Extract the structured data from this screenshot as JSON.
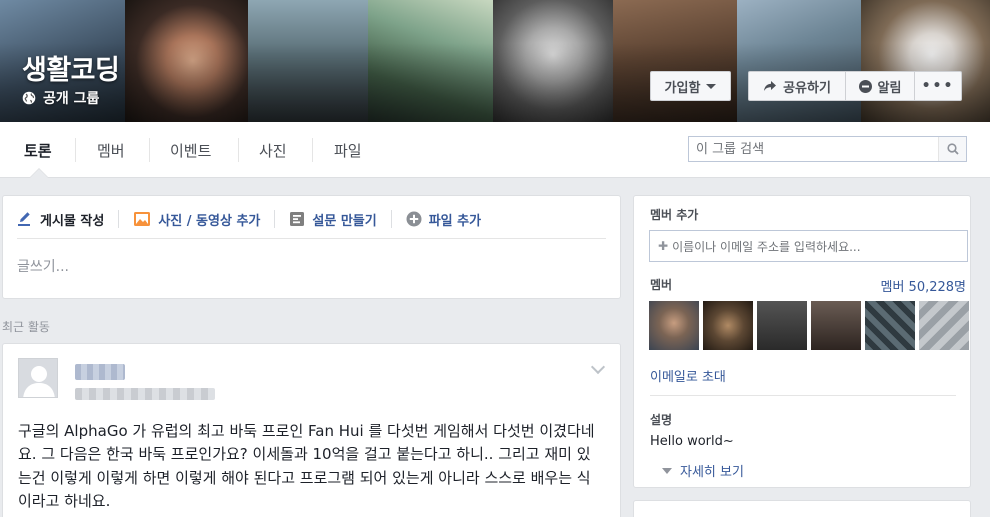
{
  "group": {
    "name": "생활코딩",
    "privacy": "공개 그룹"
  },
  "cover_actions": {
    "joined": "가입함",
    "share": "공유하기",
    "notifications": "알림",
    "more": "•••"
  },
  "tabs": [
    {
      "label": "토론",
      "active": true
    },
    {
      "label": "멤버",
      "active": false
    },
    {
      "label": "이벤트",
      "active": false
    },
    {
      "label": "사진",
      "active": false
    },
    {
      "label": "파일",
      "active": false
    }
  ],
  "search": {
    "placeholder": "이 그룹 검색"
  },
  "composer": {
    "tabs": [
      "게시물 작성",
      "사진 / 동영상 추가",
      "설문 만들기",
      "파일 추가"
    ],
    "placeholder": "글쓰기..."
  },
  "feed": {
    "section_label": "최근 활동",
    "post": {
      "text": "구글의 AlphaGo 가 유럽의 최고 바둑 프로인 Fan Hui 를 다섯번 게임해서 다섯번 이겼다네요. 그 다음은 한국 바둑 프로인가요? 이세돌과 10억을 걸고 붙는다고 하니.. 그리고 재미 있는건 이렇게 이렇게 하면 이렇게 해야 된다고 프로그램 되어 있는게 아니라 스스로 배우는 식이라고 하네요."
    }
  },
  "sidebar": {
    "add_members_title": "멤버 추가",
    "add_members_placeholder": "이름이나 이메일 주소를 입력하세요...",
    "members_title": "멤버",
    "member_count": "멤버 50,228명",
    "invite_by_email": "이메일로 초대",
    "description_title": "설명",
    "description": "Hello world~",
    "see_more": "자세히 보기"
  },
  "colors": {
    "link": "#365899",
    "background": "#e9ebee",
    "card": "#ffffff"
  }
}
